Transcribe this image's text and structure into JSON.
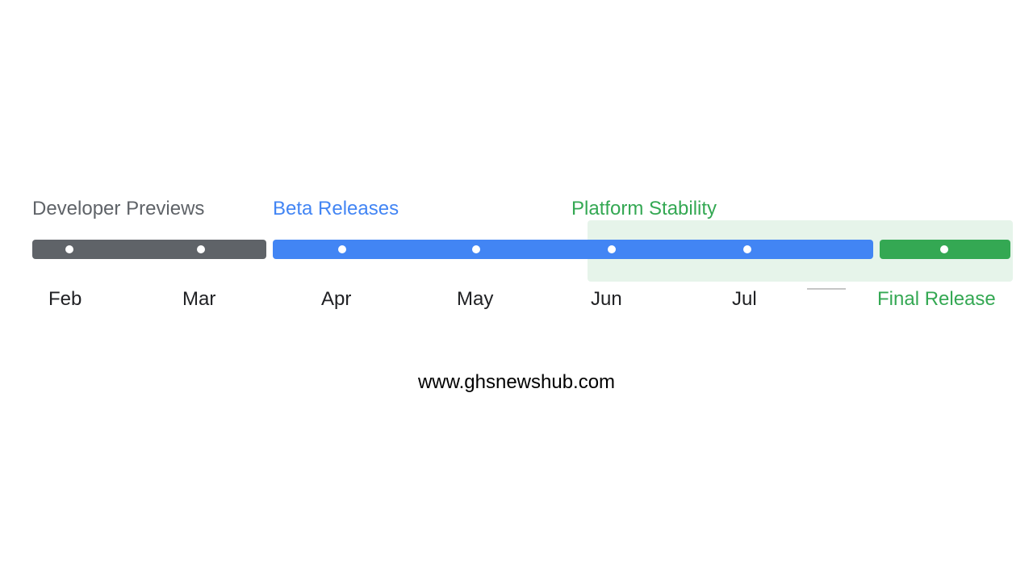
{
  "colors": {
    "dev": "#5f6368",
    "beta": "#4285f4",
    "stab": "#34a853",
    "stabBg": "#e6f4ea"
  },
  "legend": {
    "dev": "Developer Previews",
    "beta": "Beta Releases",
    "stab": "Platform Stability"
  },
  "months": {
    "feb": "Feb",
    "mar": "Mar",
    "apr": "Apr",
    "may": "May",
    "jun": "Jun",
    "jul": "Jul",
    "final": "Final Release"
  },
  "watermark": "www.ghsnewshub.com",
  "chart_data": {
    "type": "bar",
    "title": "",
    "xlabel": "",
    "ylabel": "",
    "categories": [
      "Feb",
      "Mar",
      "Apr",
      "May",
      "Jun",
      "Jul",
      "Final Release"
    ],
    "series": [
      {
        "name": "Developer Previews",
        "months": [
          "Feb",
          "Mar"
        ]
      },
      {
        "name": "Beta Releases",
        "months": [
          "Apr",
          "May",
          "Jun",
          "Jul"
        ]
      },
      {
        "name": "Platform Stability",
        "months": [
          "Jun",
          "Jul",
          "Final Release"
        ]
      }
    ]
  }
}
